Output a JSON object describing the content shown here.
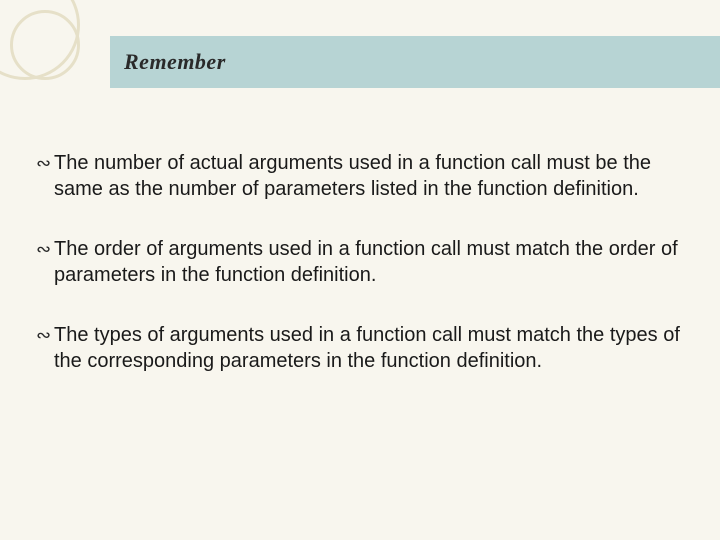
{
  "title": "Remember",
  "bullets": [
    "The number of actual arguments used in a function call must be the same as the number of parameters listed in the function definition.",
    "The order of arguments used in a function call must match the order of parameters in the function definition.",
    "The types of arguments used in a function call must match the types of the corresponding parameters in the function definition."
  ],
  "bullet_glyph": "∾"
}
